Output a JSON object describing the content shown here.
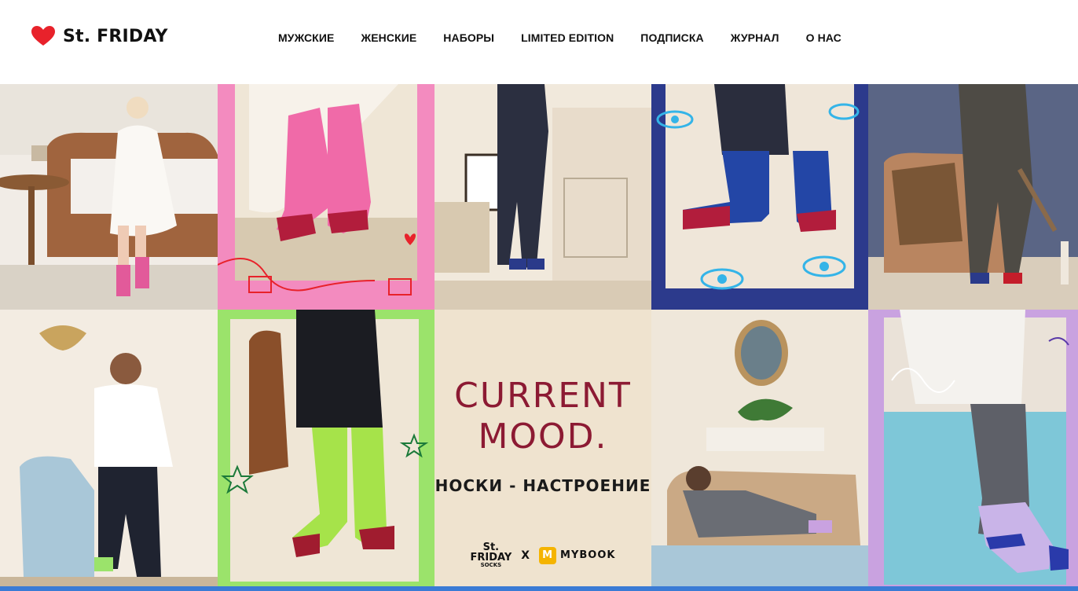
{
  "brand": {
    "name": "St. FRIDAY",
    "heart_color": "#e8222b"
  },
  "nav": {
    "items": [
      {
        "label": "МУЖСКИЕ"
      },
      {
        "label": "ЖЕНСКИЕ"
      },
      {
        "label": "НАБОРЫ"
      },
      {
        "label": "LIMITED EDITION"
      },
      {
        "label": "ПОДПИСКА"
      },
      {
        "label": "ЖУРНАЛ"
      },
      {
        "label": "О НАС"
      }
    ]
  },
  "promo": {
    "title_line1": "CURRENT",
    "title_line2": "MOOD.",
    "subtitle": "НОСКИ - НАСТРОЕНИЕ",
    "partner_brand_top": "St.",
    "partner_brand_main": "FRIDAY",
    "partner_brand_sub": "SOCKS",
    "partner_x": "X",
    "partner_name": "MYBOOK",
    "partner_icon": "M"
  },
  "colors": {
    "pink_frame": "#f38bbf",
    "navy_frame": "#2c3a8c",
    "lime_frame": "#9be36b",
    "lavender_frame": "#c9a2e0",
    "promo_bg": "#efe3cf",
    "accent_red": "#8c1a33"
  }
}
